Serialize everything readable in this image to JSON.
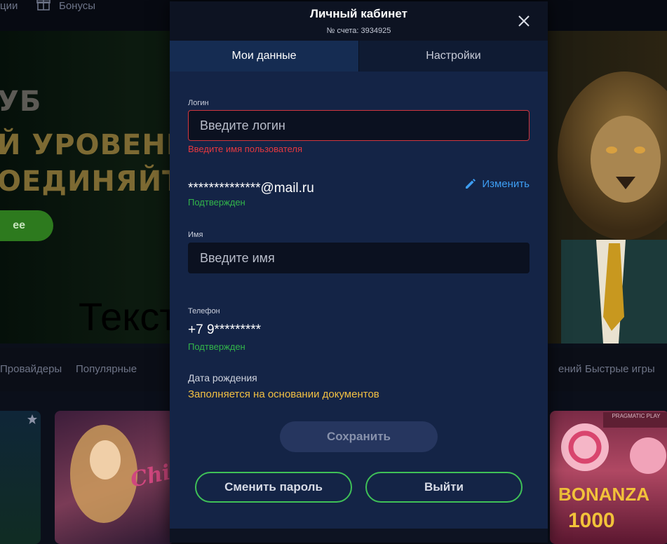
{
  "background": {
    "topbar": {
      "item_partial": "ции",
      "bonuses": "Бонусы"
    },
    "banner": {
      "line1": "УБ",
      "line2": "Й УРОВЕНЬ",
      "line3": "ОЕДИНЯЙТ",
      "button_partial": "ее"
    },
    "overlay_text": "Текст",
    "nav": [
      "Провайдеры",
      "Популярные",
      "ений",
      "Быстрые игры"
    ],
    "tiles": {
      "lucky": "Chi",
      "bonanza": "BONANZA",
      "bonanza_number": "1000",
      "provider_badge": "PRAGMATIC PLAY"
    }
  },
  "modal": {
    "title": "Личный кабинет",
    "account": "№ счета: 3934925",
    "tabs": [
      {
        "label": "Мои данные",
        "active": true
      },
      {
        "label": "Настройки",
        "active": false
      }
    ],
    "login": {
      "label": "Логин",
      "placeholder": "Введите логин",
      "error": "Введите имя пользователя"
    },
    "email": {
      "value": "**************@mail.ru",
      "status": "Подтвержден",
      "edit_label": "Изменить"
    },
    "name": {
      "label": "Имя",
      "placeholder": "Введите имя"
    },
    "phone": {
      "label": "Телефон",
      "value": "+7 9*********",
      "status": "Подтвержден"
    },
    "birth": {
      "label": "Дата рождения",
      "note": "Заполняется на основании документов"
    },
    "buttons": {
      "save": "Сохранить",
      "change_password": "Сменить пароль",
      "logout": "Выйти"
    }
  },
  "colors": {
    "error": "#e6383f",
    "verified": "#32b54a",
    "accent_green": "#3fc157",
    "link": "#3d9df2",
    "warning": "#f2c043",
    "modal_bg": "#142446"
  }
}
